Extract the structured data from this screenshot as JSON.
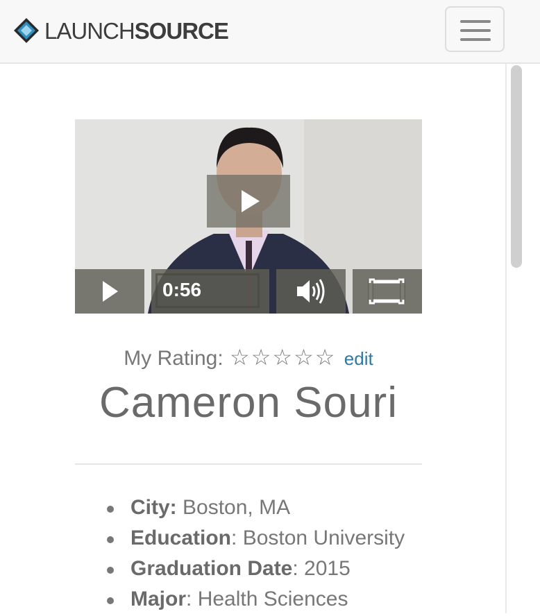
{
  "brand": {
    "thin": "LAUNCH",
    "bold": "SOURCE"
  },
  "video": {
    "time": "0:56"
  },
  "rating": {
    "label": "My Rating:",
    "edit": "edit",
    "stars_filled": 0,
    "stars_total": 5
  },
  "candidate": {
    "name": "Cameron Souri"
  },
  "details": [
    {
      "label": "City:",
      "sep": "",
      "value": " Boston, MA"
    },
    {
      "label": "Education",
      "sep": ":",
      "value": " Boston University"
    },
    {
      "label": "Graduation Date",
      "sep": ":",
      "value": " 2015"
    },
    {
      "label": "Major",
      "sep": ":",
      "value": " Health Sciences"
    }
  ],
  "colors": {
    "accent_link": "#2f7aa0",
    "logo_blue": "#2e8fc0"
  }
}
